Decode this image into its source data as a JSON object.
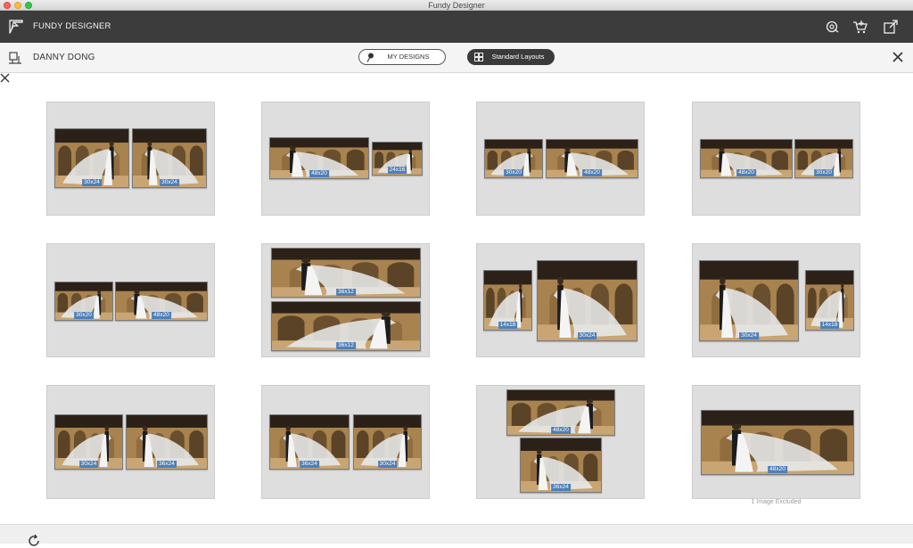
{
  "window": {
    "title": "Fundy Designer"
  },
  "appbar": {
    "app_name": "FUNDY DESIGNER",
    "icons": [
      "cart-settings-icon",
      "cart-icon",
      "export-icon"
    ]
  },
  "subbar": {
    "user_name": "DANNY DONG",
    "my_designs_label": "MY DESIGNS",
    "standard_layouts_label": "Standard Layouts"
  },
  "layouts": [
    {
      "photos": [
        "30x24",
        "30x24"
      ]
    },
    {
      "photos": [
        "48x20",
        "24x16"
      ]
    },
    {
      "photos": [
        "30x20",
        "48x20"
      ]
    },
    {
      "photos": [
        "48x20",
        "30x20"
      ]
    },
    {
      "photos": [
        "30x20",
        "48x20"
      ]
    },
    {
      "photos": [
        "36x12",
        "36x12"
      ]
    },
    {
      "photos": [
        "14x18",
        "30x24"
      ]
    },
    {
      "photos": [
        "30x24",
        "14x18"
      ]
    },
    {
      "photos": [
        "30x24",
        "36x24"
      ]
    },
    {
      "photos": [
        "36x24",
        "30x24"
      ]
    },
    {
      "photos": [
        "48x20",
        "36x24"
      ]
    },
    {
      "photos": [
        "48x20"
      ],
      "note": "1 Image Excluded"
    }
  ],
  "colors": {
    "tag_blue": "#4f7fb6",
    "appbar": "#3c3c3c",
    "card": "#dedede"
  }
}
